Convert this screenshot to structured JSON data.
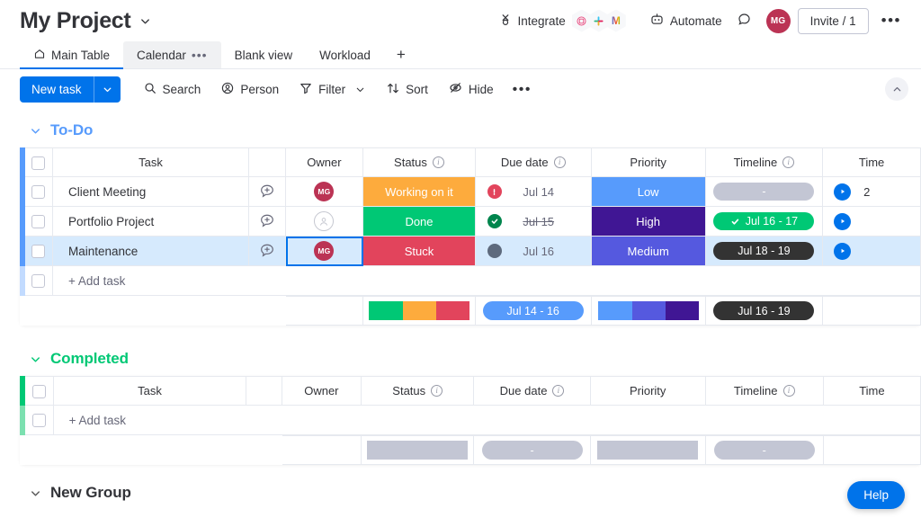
{
  "header": {
    "board_title": "My Project",
    "title_caret_icon": "chevron-down-icon",
    "integrate_label": "Integrate",
    "integrate_icon": "integrate-plug-icon",
    "app_badges": [
      {
        "name": "target-app-icon",
        "label": ""
      },
      {
        "name": "slack-app-icon",
        "label": ""
      },
      {
        "name": "gmail-app-icon",
        "label": "M"
      }
    ],
    "automate_label": "Automate",
    "automate_icon": "robot-icon",
    "chat_icon": "chat-bubble-icon",
    "avatar_initials": "MG",
    "invite_label": "Invite / 1",
    "more_label": "•••"
  },
  "tabs": [
    {
      "label": "Main Table",
      "icon": "home-icon",
      "active": true
    },
    {
      "label": "Calendar",
      "icon": "",
      "active": false,
      "hovered": true,
      "dots": "•••"
    },
    {
      "label": "Blank view",
      "icon": "",
      "active": false
    },
    {
      "label": "Workload",
      "icon": "",
      "active": false
    }
  ],
  "tab_add_label": "+",
  "toolbar": {
    "new_task_label": "New task",
    "new_task_caret_icon": "chevron-down-icon",
    "search_label": "Search",
    "search_icon": "search-icon",
    "person_label": "Person",
    "person_icon": "person-icon",
    "filter_label": "Filter",
    "filter_icon": "funnel-icon",
    "filter_caret_icon": "chevron-down-icon",
    "sort_label": "Sort",
    "sort_icon": "sort-arrows-icon",
    "hide_label": "Hide",
    "hide_icon": "eye-off-icon",
    "more_label": "•••",
    "collapse_icon": "chevron-up-icon"
  },
  "columns": {
    "task": "Task",
    "owner": "Owner",
    "status": "Status",
    "due_date": "Due date",
    "priority": "Priority",
    "timeline": "Timeline",
    "time_tracking": "Time"
  },
  "colors": {
    "accent_blue": "#0073ea",
    "group_todo": "#579bfc",
    "group_completed": "#00c875",
    "status_working": "#fdab3d",
    "status_done": "#00c875",
    "status_stuck": "#e2445c",
    "priority_low": "#579bfc",
    "priority_high": "#401694",
    "priority_medium": "#5559df",
    "timeline_empty": "#c3c6d4",
    "timeline_done": "#00c875",
    "timeline_dark": "#333333",
    "avatar": "#bb3354",
    "row_selected": "#d6eafd",
    "placeholder_grey": "#c3c6d4"
  },
  "groups": [
    {
      "name": "To-Do",
      "color": "#579bfc",
      "caret_icon": "chevron-down-icon",
      "add_task_label": "+ Add task",
      "rows": [
        {
          "task": "Client Meeting",
          "chat_icon": "add-comment-icon",
          "owner_initials": "MG",
          "owner_empty": false,
          "status": "Working on it",
          "status_color": "#fdab3d",
          "due_date": "Jul 14",
          "due_indicator": "alert",
          "due_indicator_color": "#e2445c",
          "due_strike": false,
          "priority": "Low",
          "priority_color": "#579bfc",
          "timeline": "-",
          "timeline_color": "#c3c6d4",
          "timeline_check": false,
          "time_value": "2",
          "play_icon": "play-icon",
          "selected": false
        },
        {
          "task": "Portfolio Project",
          "chat_icon": "add-comment-icon",
          "owner_initials": "",
          "owner_empty": true,
          "status": "Done",
          "status_color": "#00c875",
          "due_date": "Jul 15",
          "due_indicator": "check",
          "due_indicator_color": "#00854d",
          "due_strike": true,
          "priority": "High",
          "priority_color": "#401694",
          "timeline": "Jul 16 - 17",
          "timeline_color": "#00c875",
          "timeline_check": true,
          "time_value": "",
          "play_icon": "play-icon",
          "selected": false
        },
        {
          "task": "Maintenance",
          "chat_icon": "add-comment-icon",
          "owner_initials": "MG",
          "owner_empty": false,
          "status": "Stuck",
          "status_color": "#e2445c",
          "due_date": "Jul 16",
          "due_indicator": "dot",
          "due_indicator_color": "#5e6a7d",
          "due_strike": false,
          "priority": "Medium",
          "priority_color": "#5559df",
          "timeline": "Jul 18 - 19",
          "timeline_color": "#333333",
          "timeline_check": false,
          "time_value": "",
          "play_icon": "play-icon",
          "selected": true
        }
      ],
      "summary": {
        "status_segments": [
          {
            "color": "#00c875",
            "fraction": 0.34
          },
          {
            "color": "#fdab3d",
            "fraction": 0.33
          },
          {
            "color": "#e2445c",
            "fraction": 0.33
          }
        ],
        "due_pill": "Jul 14 - 16",
        "due_pill_color": "#579bfc",
        "priority_segments": [
          {
            "color": "#579bfc",
            "fraction": 0.34
          },
          {
            "color": "#5559df",
            "fraction": 0.33
          },
          {
            "color": "#401694",
            "fraction": 0.33
          }
        ],
        "timeline_pill": "Jul 16 - 19",
        "timeline_pill_color": "#333333"
      }
    },
    {
      "name": "Completed",
      "color": "#00c875",
      "caret_icon": "chevron-down-icon",
      "add_task_label": "+ Add task",
      "rows": [],
      "summary": {
        "status_placeholder": "",
        "due_placeholder": "-",
        "priority_placeholder": "",
        "timeline_placeholder": "-"
      }
    },
    {
      "name": "New Group",
      "color": "#a25ddc",
      "caret_icon": "chevron-down-icon",
      "add_task_label": "+ Add task",
      "rows": [],
      "summary": {}
    }
  ],
  "help": {
    "label": "Help"
  }
}
